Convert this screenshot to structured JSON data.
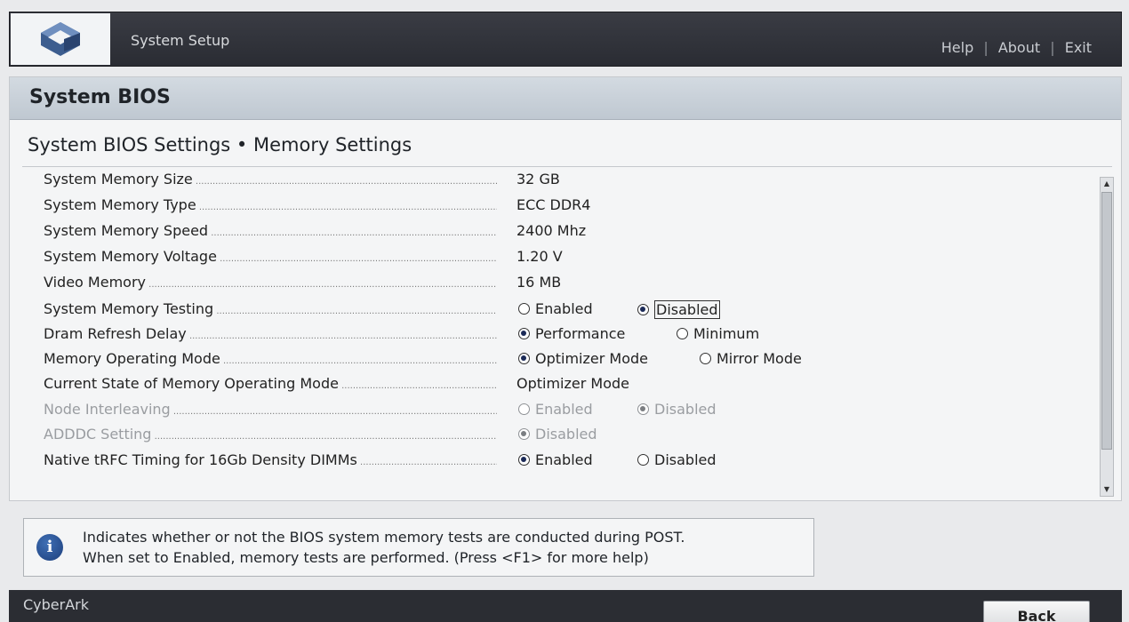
{
  "header": {
    "title": "System Setup",
    "links": {
      "help": "Help",
      "about": "About",
      "exit": "Exit",
      "separator": "|"
    }
  },
  "panel": {
    "heading": "System BIOS",
    "subheading": "System BIOS Settings • Memory Settings"
  },
  "settings": [
    {
      "label": "System Memory Size",
      "value": "32 GB"
    },
    {
      "label": "System Memory Type",
      "value": "ECC DDR4"
    },
    {
      "label": "System Memory Speed",
      "value": "2400 Mhz"
    },
    {
      "label": "System Memory Voltage",
      "value": "1.20 V"
    },
    {
      "label": "Video Memory",
      "value": "16 MB"
    },
    {
      "label": "System Memory Testing",
      "options": [
        "Enabled",
        "Disabled"
      ],
      "selected": "Disabled"
    },
    {
      "label": "Dram Refresh Delay",
      "options": [
        "Performance",
        "Minimum"
      ],
      "selected": "Performance"
    },
    {
      "label": "Memory Operating Mode",
      "options": [
        "Optimizer Mode",
        "Mirror Mode"
      ],
      "selected": "Optimizer Mode"
    },
    {
      "label": "Current State of Memory Operating Mode",
      "value": "Optimizer Mode"
    },
    {
      "label": "Node Interleaving",
      "options": [
        "Enabled",
        "Disabled"
      ],
      "selected": "Disabled",
      "disabled": true
    },
    {
      "label": "ADDDC Setting",
      "options": [
        "Disabled"
      ],
      "selected": "Disabled",
      "disabled": true
    },
    {
      "label": "Native tRFC Timing for 16Gb Density DIMMs",
      "options": [
        "Enabled",
        "Disabled"
      ],
      "selected": "Enabled"
    }
  ],
  "help": {
    "line1": "Indicates whether or not the BIOS system memory tests are conducted during POST.",
    "line2": "When set to Enabled, memory tests are performed. (Press <F1> for more help)"
  },
  "footer": {
    "brand": "CyberArk",
    "back_label": "Back"
  }
}
